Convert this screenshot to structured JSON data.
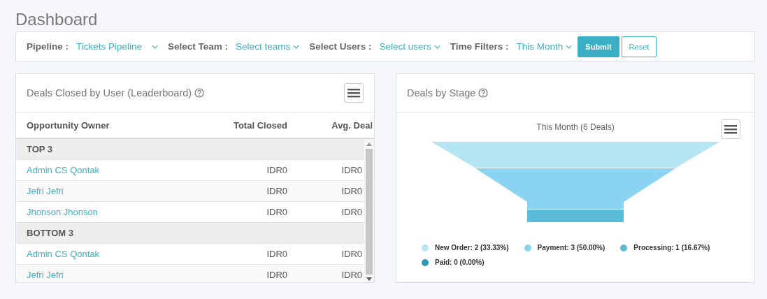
{
  "page_title": "Dashboard",
  "filters": [
    {
      "label": "Pipeline :",
      "value": "Tickets Pipeline"
    },
    {
      "label": "Select Team :",
      "value": "Select teams"
    },
    {
      "label": "Select Users :",
      "value": "Select users"
    },
    {
      "label": "Time Filters :",
      "value": "This Month"
    }
  ],
  "buttons": [
    {
      "label": "Submit",
      "kind": "primary"
    },
    {
      "label": "Reset",
      "kind": "outline"
    }
  ],
  "leaderboard": {
    "title": "Deals Closed by User (Leaderboard)",
    "columns": [
      "Opportunity Owner",
      "Total Closed",
      "Avg. Deal"
    ],
    "rows": [
      {
        "kind": "group",
        "label": "TOP 3"
      },
      {
        "kind": "user",
        "name": "Admin CS Qontak",
        "total": "IDR0",
        "avg": "IDR0"
      },
      {
        "kind": "user",
        "name": "Jefri Jefri",
        "total": "IDR0",
        "avg": "IDR0"
      },
      {
        "kind": "user",
        "name": "Jhonson Jhonson",
        "total": "IDR0",
        "avg": "IDR0"
      },
      {
        "kind": "group",
        "label": "BOTTOM 3"
      },
      {
        "kind": "user",
        "name": "Admin CS Qontak",
        "total": "IDR0",
        "avg": "IDR0"
      },
      {
        "kind": "user",
        "name": "Jefri Jefri",
        "total": "IDR0",
        "avg": "IDR0"
      }
    ]
  },
  "deals_by_stage": {
    "title": "Deals by Stage",
    "subtitle": "This Month (6 Deals)",
    "legend": [
      {
        "label": "New Order: 2 (33.33%)",
        "color": "#b3e5f3"
      },
      {
        "label": "Payment: 3 (50.00%)",
        "color": "#8ad4f2"
      },
      {
        "label": "Processing: 1 (16.67%)",
        "color": "#5bbcd9"
      },
      {
        "label": "Paid: 0 (0.00%)",
        "color": "#2a9bb5"
      }
    ]
  }
}
